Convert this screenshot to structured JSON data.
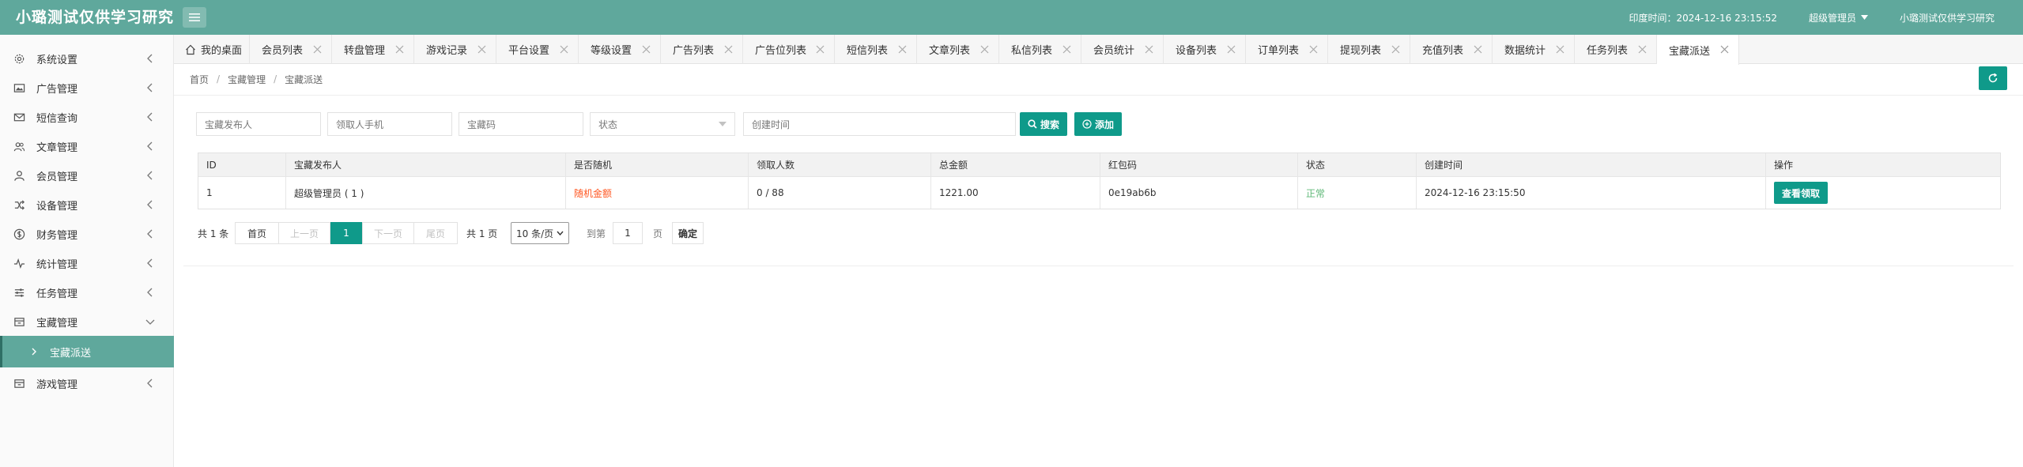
{
  "app": {
    "title": "小璐测试仅供学习研究"
  },
  "header": {
    "time_label": "印度时间：",
    "time_value": "2024-12-16 23:15:52",
    "user": "超级管理员",
    "site_name": "小璐测试仅供学习研究"
  },
  "sidebar": {
    "items": [
      {
        "label": "系统设置",
        "icon": "gear-icon"
      },
      {
        "label": "广告管理",
        "icon": "image-icon"
      },
      {
        "label": "短信查询",
        "icon": "mail-icon"
      },
      {
        "label": "文章管理",
        "icon": "users-icon"
      },
      {
        "label": "会员管理",
        "icon": "user-icon"
      },
      {
        "label": "设备管理",
        "icon": "shuffle-icon"
      },
      {
        "label": "财务管理",
        "icon": "dollar-icon"
      },
      {
        "label": "统计管理",
        "icon": "pulse-icon"
      },
      {
        "label": "任务管理",
        "icon": "sliders-icon"
      },
      {
        "label": "宝藏管理",
        "icon": "box-icon"
      },
      {
        "label": "宝藏派送",
        "icon": "chevron-right-icon"
      },
      {
        "label": "游戏管理",
        "icon": "box-icon"
      }
    ]
  },
  "tabs": [
    {
      "label": "我的桌面"
    },
    {
      "label": "会员列表"
    },
    {
      "label": "转盘管理"
    },
    {
      "label": "游戏记录"
    },
    {
      "label": "平台设置"
    },
    {
      "label": "等级设置"
    },
    {
      "label": "广告列表"
    },
    {
      "label": "广告位列表"
    },
    {
      "label": "短信列表"
    },
    {
      "label": "文章列表"
    },
    {
      "label": "私信列表"
    },
    {
      "label": "会员统计"
    },
    {
      "label": "设备列表"
    },
    {
      "label": "订单列表"
    },
    {
      "label": "提现列表"
    },
    {
      "label": "充值列表"
    },
    {
      "label": "数据统计"
    },
    {
      "label": "任务列表"
    },
    {
      "label": "宝藏派送"
    }
  ],
  "breadcrumb": {
    "home": "首页",
    "parent": "宝藏管理",
    "current": "宝藏派送",
    "sep": "/"
  },
  "filters": {
    "publisher": "宝藏发布人",
    "receiver_phone": "领取人手机",
    "code": "宝藏码",
    "status": "状态",
    "created_time": "创建时间",
    "search_label": "搜索",
    "add_label": "添加"
  },
  "table": {
    "headers": [
      "ID",
      "宝藏发布人",
      "是否随机",
      "领取人数",
      "总金额",
      "红包码",
      "状态",
      "创建时间",
      "操作"
    ],
    "rows": [
      {
        "id": "1",
        "publisher": "超级管理员 ( 1 )",
        "random": "随机金额",
        "claimed": "0 / 88",
        "total": "1221.00",
        "code": "0e19ab6b",
        "status": "正常",
        "created": "2024-12-16 23:15:50",
        "action": "查看领取"
      }
    ]
  },
  "pagination": {
    "total": "共 1 条",
    "first": "首页",
    "prev": "上一页",
    "current": "1",
    "next": "下一页",
    "last": "尾页",
    "pages": "共 1 页",
    "per_page": "10 条/页",
    "goto_label": "到第",
    "goto_value": "1",
    "page_unit": "页",
    "confirm": "确定"
  },
  "colors": {
    "header": "#5fa89c",
    "primary": "#0f9a8a",
    "red": "#ff5722",
    "green": "#5fb878"
  }
}
